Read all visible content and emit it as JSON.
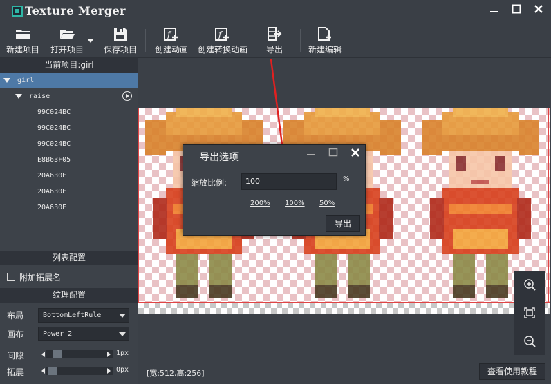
{
  "window": {
    "title": "Texture Merger",
    "controls": [
      "minimize-icon",
      "maximize-icon",
      "close-icon"
    ]
  },
  "toolbar": {
    "new_project": "新建项目",
    "open_project": "打开项目",
    "save_project": "保存项目",
    "create_animation": "创建动画",
    "create_convert_animation": "创建转换动画",
    "export": "导出",
    "new_edit": "新建编辑"
  },
  "left_panel": {
    "current_project_label": "当前项目:girl",
    "tree": {
      "root": "girl",
      "group": "raise",
      "items": [
        "99C024BC",
        "99C024BC",
        "99C024BC",
        "E8B63F05",
        "20A630E",
        "20A630E",
        "20A630E"
      ]
    },
    "list_config_title": "列表配置",
    "append_ext_label": "附加拓展名",
    "append_ext_checked": false,
    "texture_config_title": "纹理配置",
    "layout_label": "布局",
    "layout_value": "BottomLeftRule",
    "canvas_label": "画布",
    "canvas_value": "Power 2",
    "gap_label": "间隙",
    "gap_value": "1px",
    "extend_label": "拓展",
    "extend_value": "0px"
  },
  "status": {
    "size_text": "[宽:512,高:256]",
    "tutorial_button": "查看使用教程"
  },
  "export_dialog": {
    "title": "导出选项",
    "scale_label": "缩放比例:",
    "scale_value": "100",
    "percent_sign": "%",
    "presets": [
      "200%",
      "100%",
      "50%"
    ],
    "export_button": "导出"
  },
  "colors": {
    "accent": "#4e79a6",
    "frame_line": "#e04545",
    "annotation_arrow": "#e02020",
    "logo": "#2fb7a6"
  }
}
